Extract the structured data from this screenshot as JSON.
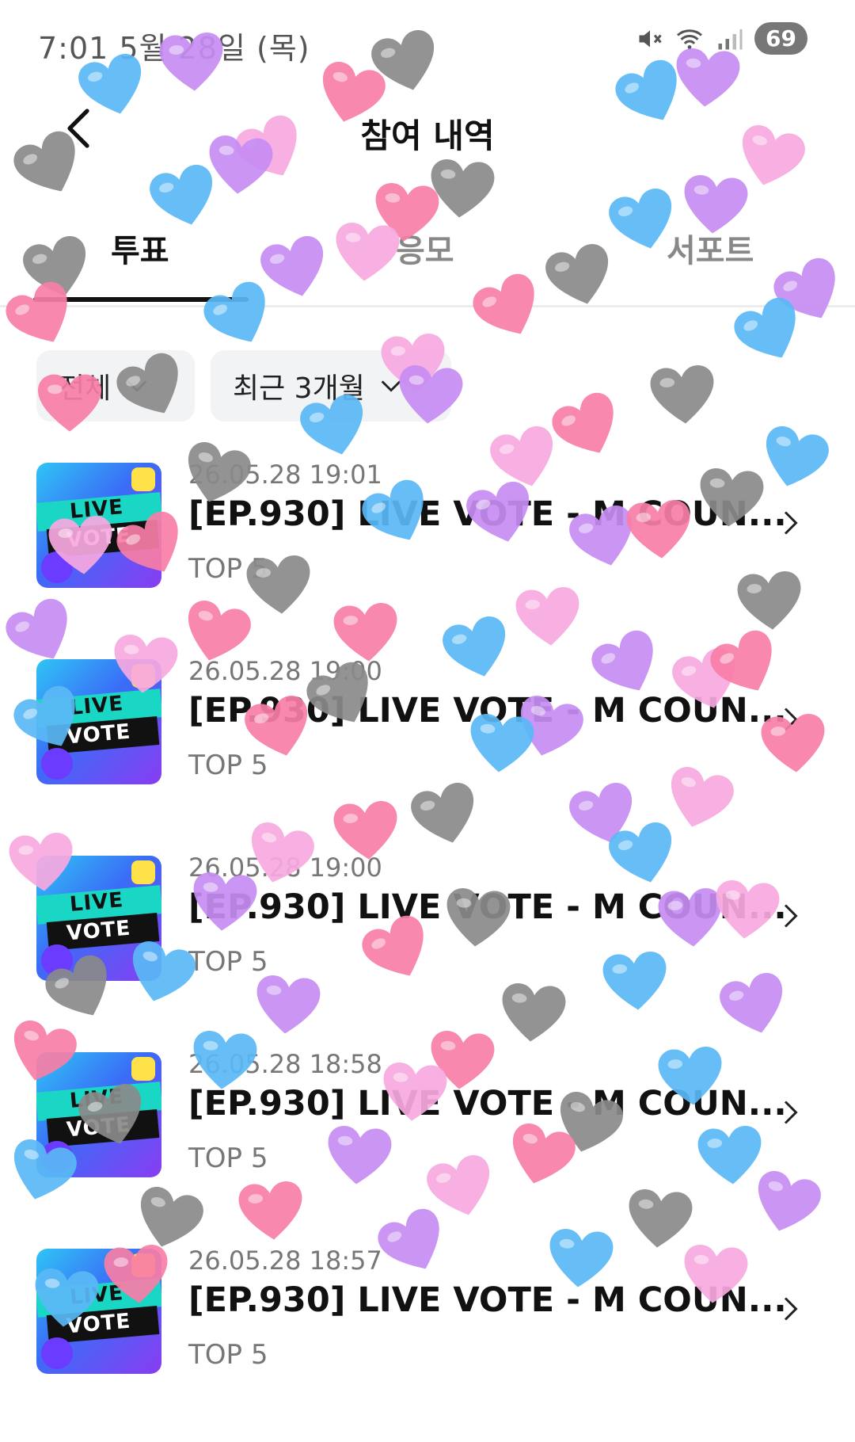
{
  "status_bar": {
    "time": "7:01  5월 28일 (목)",
    "battery": "69"
  },
  "header": {
    "title": "참여 내역"
  },
  "tabs": [
    {
      "label": "투표",
      "active": true
    },
    {
      "label": "응모",
      "active": false
    },
    {
      "label": "서포트",
      "active": false
    }
  ],
  "filters": {
    "category": "전체",
    "period": "최근 3개월"
  },
  "thumbnail_text": {
    "line1": "LIVE",
    "line2": "VOTE"
  },
  "items": [
    {
      "date": "26.05.28 19:01",
      "title": "[EP.930] LIVE VOTE - M COUN...",
      "subtitle": "TOP 5"
    },
    {
      "date": "26.05.28 19:00",
      "title": "[EP.930] LIVE VOTE - M COUN...",
      "subtitle": "TOP 5"
    },
    {
      "date": "26.05.28 19:00",
      "title": "[EP.930] LIVE VOTE - M COUN...",
      "subtitle": "TOP 5"
    },
    {
      "date": "26.05.28 18:58",
      "title": "[EP.930] LIVE VOTE - M COUN...",
      "subtitle": "TOP 5"
    },
    {
      "date": "26.05.28 18:57",
      "title": "[EP.930] LIVE VOTE - M COUN...",
      "subtitle": "TOP 5"
    }
  ],
  "colors": {
    "heart_blue": "#5ab8f5",
    "heart_purple": "#c58cf2",
    "heart_pink": "#f77ea6",
    "heart_grey": "#8a8a8a",
    "heart_lightpink": "#f7a8e0"
  }
}
